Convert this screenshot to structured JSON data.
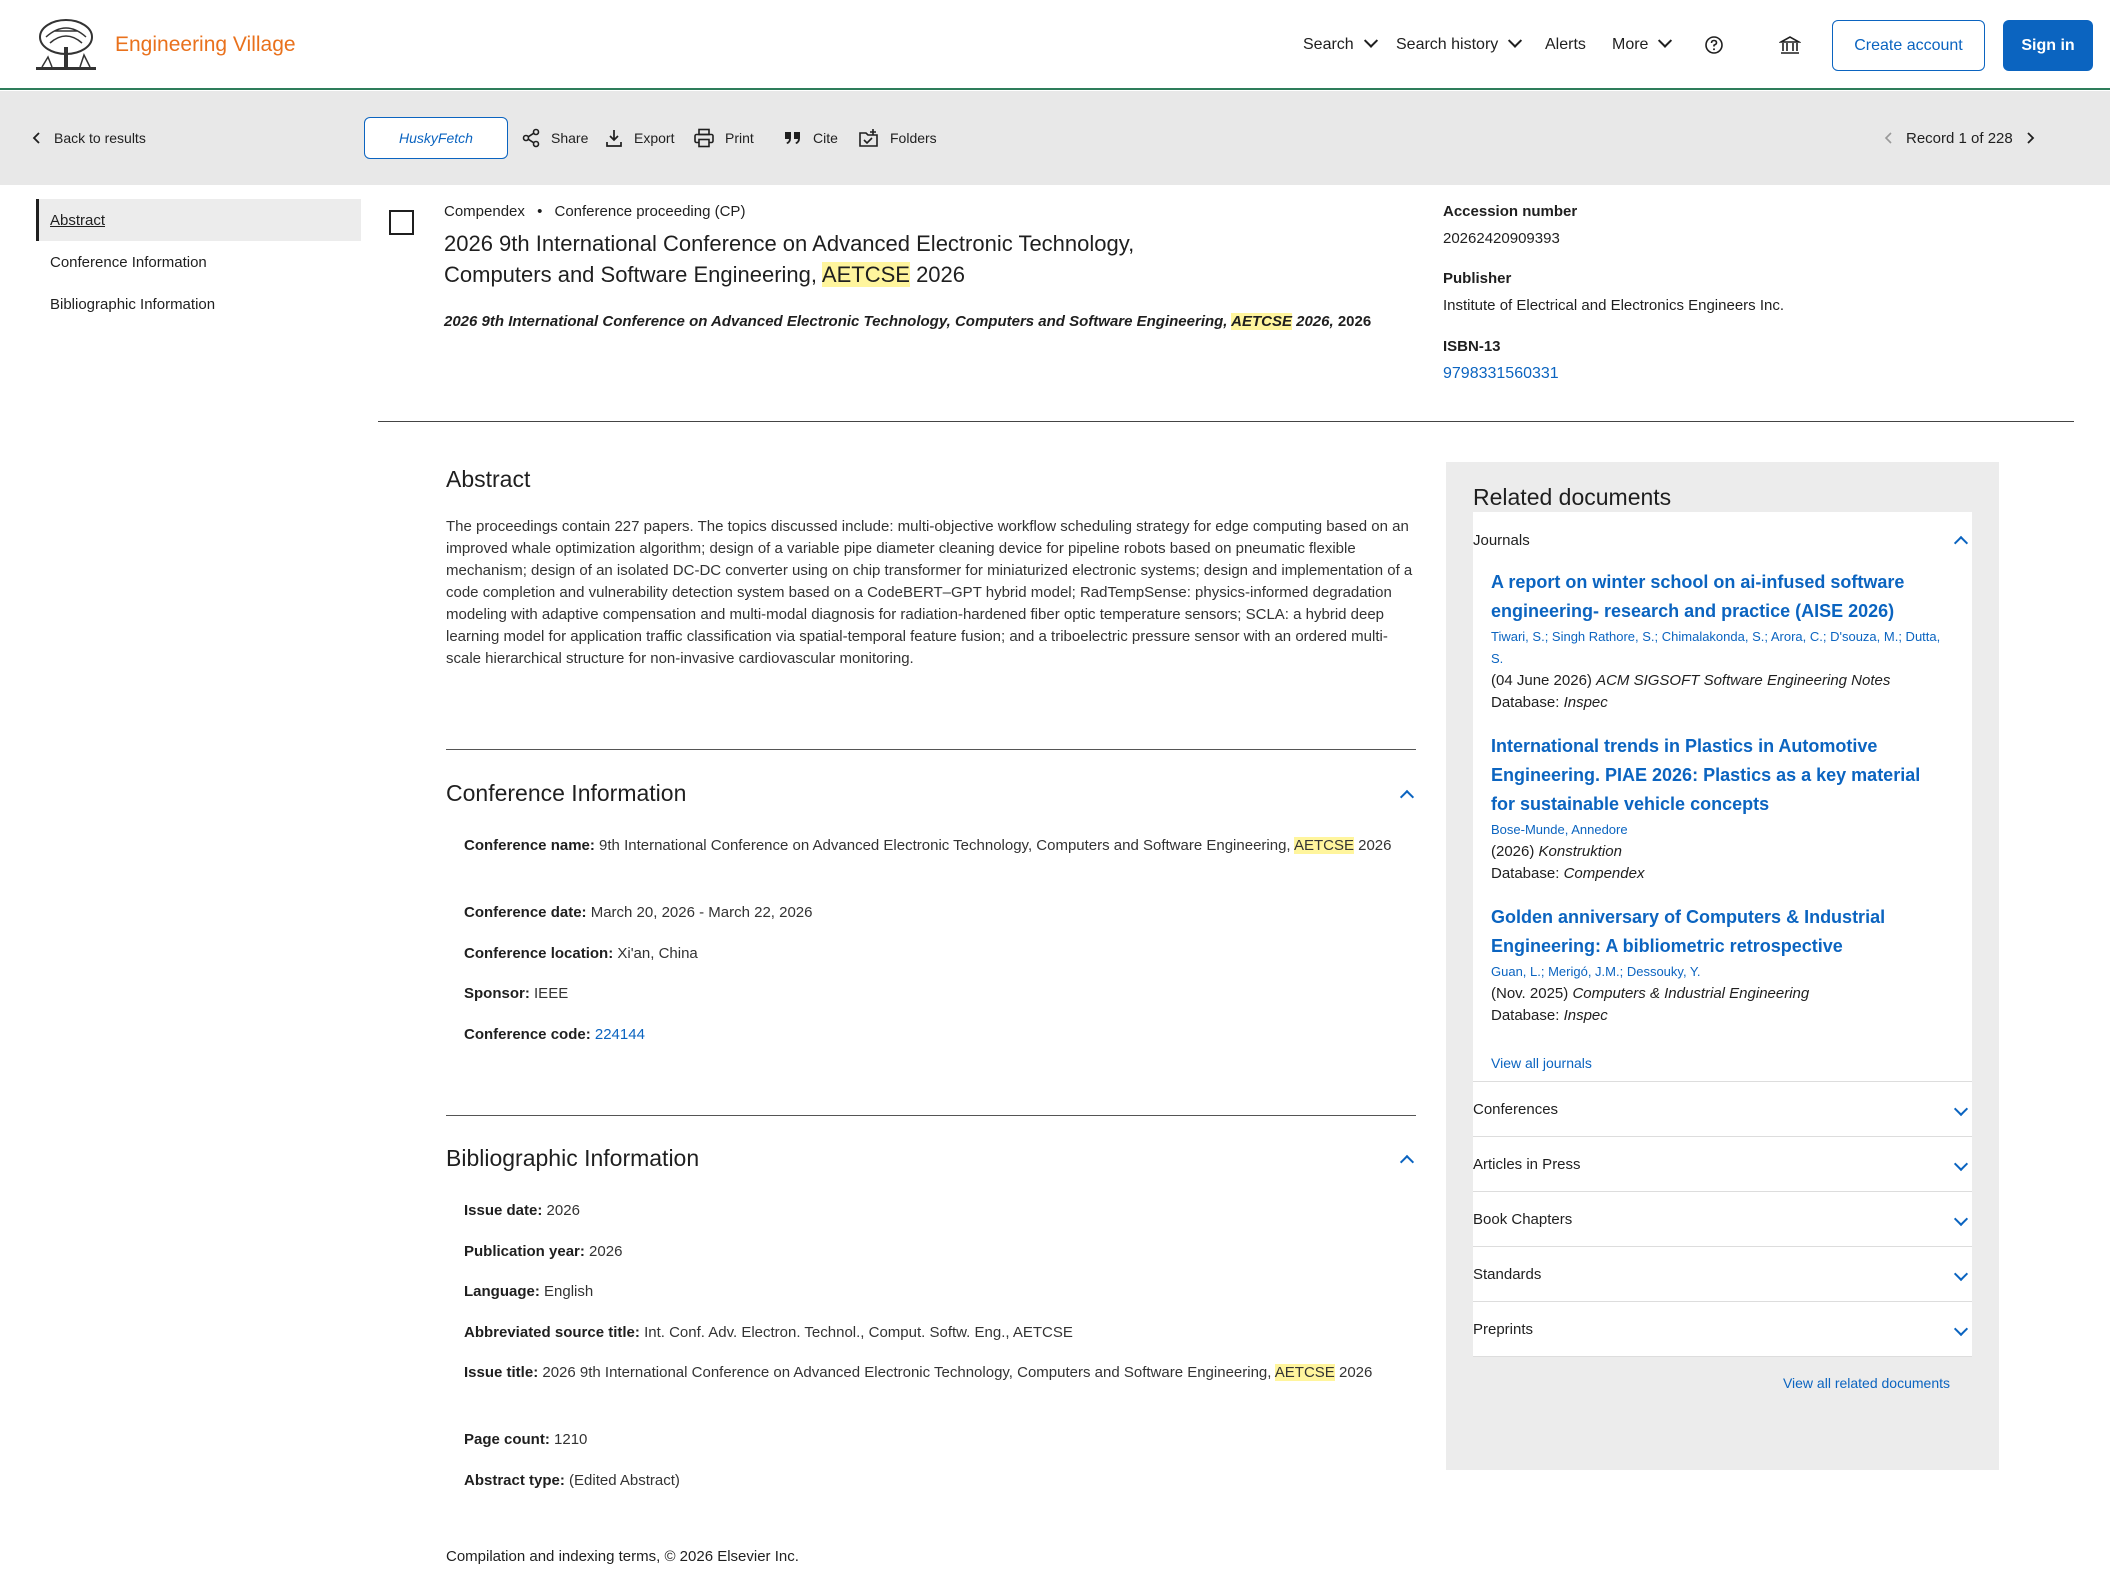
{
  "brand": {
    "name": "Engineering Village"
  },
  "topnav": {
    "search": "Search",
    "search_history": "Search history",
    "alerts": "Alerts",
    "more": "More",
    "create_account": "Create account",
    "sign_in": "Sign in"
  },
  "toolbar": {
    "back": "Back to results",
    "husky": "HuskyFetch",
    "share": "Share",
    "export": "Export",
    "print": "Print",
    "cite": "Cite",
    "folders": "Folders",
    "record": "Record 1 of 228"
  },
  "leftnav": [
    "Abstract",
    "Conference Information",
    "Bibliographic Information"
  ],
  "record": {
    "database": "Compendex",
    "doctype": "Conference proceeding (CP)",
    "title_pre": "2026 9th International Conference on Advanced Electronic Technology, Computers and Software Engineering,",
    "title_mark": "AETCSE",
    "title_post": "2026",
    "source_pre": "2026 9th International Conference on Advanced Electronic Technology, Computers and Software Engineering,",
    "source_mark": "AETCSE",
    "source_post": "2026,",
    "source_year": "2026"
  },
  "aside": {
    "accession_label": "Accession number",
    "accession_value": "20262420909393",
    "publisher_label": "Publisher",
    "publisher_value": "Institute of Electrical and Electronics Engineers Inc.",
    "isbn_label": "ISBN-13",
    "isbn_value": "9798331560331"
  },
  "abstract": {
    "heading": "Abstract",
    "body": "The proceedings contain 227 papers. The topics discussed include: multi-objective workflow scheduling strategy for edge computing based on an improved whale optimization algorithm; design of a variable pipe diameter cleaning device for pipeline robots based on pneumatic flexible mechanism; design of an isolated DC-DC converter using on chip transformer for miniaturized electronic systems; design and implementation of a code completion and vulnerability detection system based on a CodeBERT–GPT hybrid model; RadTempSense: physics-informed degradation modeling with adaptive compensation and multi-modal diagnosis for radiation-hardened fiber optic temperature sensors; SCLA: a hybrid deep learning model for application traffic classification via spatial-temporal feature fusion; and a triboelectric pressure sensor with an ordered multi-scale hierarchical structure for non-invasive cardiovascular monitoring."
  },
  "conference": {
    "heading": "Conference Information",
    "name_label": "Conference name:",
    "name_pre": "9th International Conference on Advanced Electronic Technology, Computers and Software Engineering,",
    "name_mark": "AETCSE",
    "name_post": "2026",
    "date_label": "Conference date:",
    "date_value": "March 20, 2026 - March 22, 2026",
    "location_label": "Conference location:",
    "location_value": "Xi'an, China",
    "sponsor_label": "Sponsor:",
    "sponsor_value": "IEEE",
    "code_label": "Conference code:",
    "code_value": "224144"
  },
  "biblio": {
    "heading": "Bibliographic Information",
    "issue_date_label": "Issue date:",
    "issue_date_value": "2026",
    "pub_year_label": "Publication year:",
    "pub_year_value": "2026",
    "language_label": "Language:",
    "language_value": "English",
    "abbrev_label": "Abbreviated source title:",
    "abbrev_value": "Int. Conf. Adv. Electron. Technol., Comput. Softw. Eng., AETCSE",
    "issue_title_label": "Issue title:",
    "issue_title_pre": "2026 9th International Conference on Advanced Electronic Technology, Computers and Software Engineering,",
    "issue_title_mark": "AETCSE",
    "issue_title_post": "2026",
    "page_count_label": "Page count:",
    "page_count_value": "1210",
    "abstract_type_label": "Abstract type:",
    "abstract_type_value": "(Edited Abstract)"
  },
  "footer": "Compilation and indexing terms, © 2026 Elsevier Inc.",
  "related": {
    "heading": "Related documents",
    "journals_label": "Journals",
    "docs": [
      {
        "title": "A report on winter school on ai-infused software engineering- research and practice (AISE 2026)",
        "authors": "Tiwari, S.;  Singh Rathore, S.;  Chimalakonda, S.;  Arora, C.;  D'souza, M.;  Dutta, S.",
        "date": "(04 June 2026)",
        "journal": "ACM SIGSOFT Software Engineering Notes",
        "db_label": "Database:",
        "db": "Inspec"
      },
      {
        "title": "International trends in Plastics in Automotive Engineering. PIAE 2026: Plastics as a key material for sustainable vehicle concepts",
        "authors": "Bose-Munde, Annedore",
        "date": "(2026)",
        "journal": "Konstruktion",
        "db_label": "Database:",
        "db": "Compendex"
      },
      {
        "title": "Golden anniversary of Computers & Industrial Engineering: A bibliometric retrospective",
        "authors": "Guan, L.;  Merigó, J.M.;  Dessouky, Y.",
        "date": "(Nov. 2025)",
        "journal": "Computers & Industrial Engineering",
        "db_label": "Database:",
        "db": "Inspec"
      }
    ],
    "view_all_journals": "View all journals",
    "sections": [
      "Conferences",
      "Articles in Press",
      "Book Chapters",
      "Standards",
      "Preprints"
    ],
    "view_all_related": "View all related documents"
  },
  "colors": {
    "brand": "#e9711c",
    "link": "#0b64c0",
    "highlight": "#fff59d",
    "header_rule": "#2e7d5b"
  }
}
